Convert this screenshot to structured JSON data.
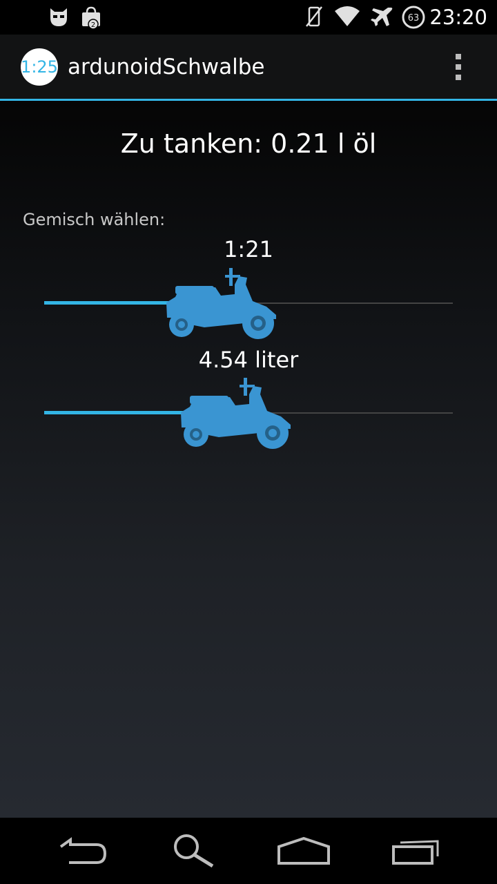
{
  "status_bar": {
    "time": "23:20",
    "battery_level": "63",
    "notification_badge": "2",
    "icons": [
      "cat-face-icon",
      "shopping-bag-icon",
      "vibrate-off-icon",
      "wifi-icon",
      "airplane-icon",
      "battery-icon"
    ]
  },
  "action_bar": {
    "app_icon_text": "1:25",
    "title": "ardunoidSchwalbe",
    "overflow_icon": "overflow-menu-icon"
  },
  "main": {
    "result_text": "Zu tanken: 0.21 l öl",
    "mix_label": "Gemisch wählen:",
    "sliders": [
      {
        "value_text": "1:21",
        "fraction": 0.42,
        "thumb_icon": "scooter-icon"
      },
      {
        "value_text": "4.54 liter",
        "fraction": 0.455,
        "thumb_icon": "scooter-icon"
      }
    ]
  },
  "nav_bar": {
    "buttons": [
      "back-icon",
      "search-icon",
      "home-icon",
      "recent-apps-icon"
    ]
  },
  "colors": {
    "accent": "#33b5e5",
    "scooter": "#3a95d2"
  }
}
